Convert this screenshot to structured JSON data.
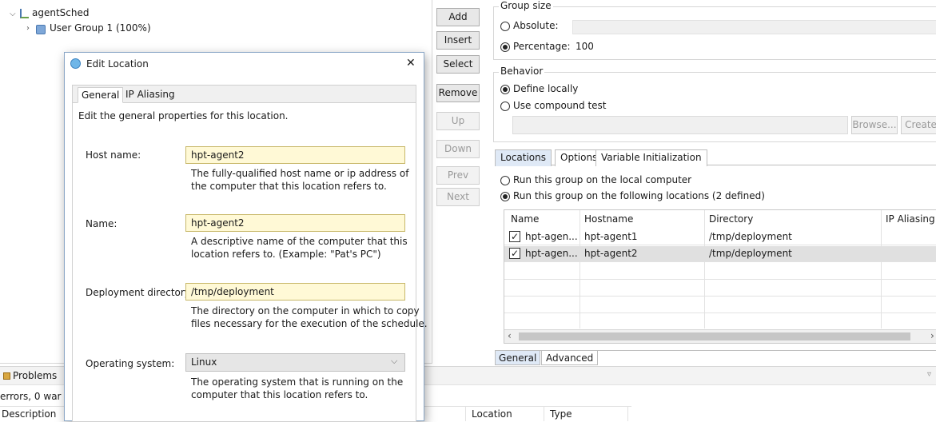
{
  "tree": {
    "root_label": "agentSched",
    "child_label": "User Group 1 (100%)"
  },
  "side_buttons": {
    "add": "Add",
    "insert": "Insert",
    "select": "Select",
    "remove": "Remove",
    "up": "Up",
    "down": "Down",
    "prev": "Prev",
    "next": "Next"
  },
  "group_size": {
    "title": "Group size",
    "absolute_label": "Absolute:",
    "percentage_label": "Percentage:",
    "percentage_value": "100",
    "selected": "percentage"
  },
  "behavior": {
    "title": "Behavior",
    "define_locally": "Define locally",
    "use_compound": "Use compound test",
    "browse_label": "Browse...",
    "create_label": "Create"
  },
  "location_tabs": [
    "Locations",
    "Options",
    "Variable Initialization"
  ],
  "run_options": {
    "local": "Run this group on the local computer",
    "following": "Run this group on the following locations (2 defined)"
  },
  "locations_table": {
    "headers": [
      "Name",
      "Hostname",
      "Directory",
      "IP Aliasing"
    ],
    "rows": [
      {
        "name": "hpt-agen...",
        "hostname": "hpt-agent1",
        "directory": "/tmp/deployment",
        "checked": true
      },
      {
        "name": "hpt-agen...",
        "hostname": "hpt-agent2",
        "directory": "/tmp/deployment",
        "checked": true
      }
    ]
  },
  "bottom_tabs": [
    "General",
    "Advanced"
  ],
  "problems": {
    "tab_label": "Problems",
    "summary": "errors, 0 war",
    "col_description": "Description",
    "col_location": "Location",
    "col_type": "Type"
  },
  "dialog": {
    "title": "Edit Location",
    "close_glyph": "✕",
    "tabs": [
      "General",
      "IP Aliasing"
    ],
    "intro": "Edit the general properties for this location.",
    "host_label": "Host name:",
    "host_value": "hpt-agent2",
    "host_help_1": "The fully-qualified host name or ip address of",
    "host_help_2": "the computer that this location refers to.",
    "name_label": "Name:",
    "name_value": "hpt-agent2",
    "name_help_1": "A descriptive name of the computer that this",
    "name_help_2": "location refers to.  (Example:  \"Pat's PC\")",
    "dir_label": "Deployment directory:",
    "dir_value": "/tmp/deployment",
    "dir_help_1": "The directory on the computer in which to copy",
    "dir_help_2": "files necessary for the execution of the schedule.",
    "os_label": "Operating system:",
    "os_value": "Linux",
    "os_help_1": "The operating system that is running on the",
    "os_help_2": "computer that this location refers to."
  },
  "colors": {
    "input_yellow": "#fff9d6",
    "selected_row": "#e0e0e0",
    "tab_selected": "#dfe9f6"
  }
}
